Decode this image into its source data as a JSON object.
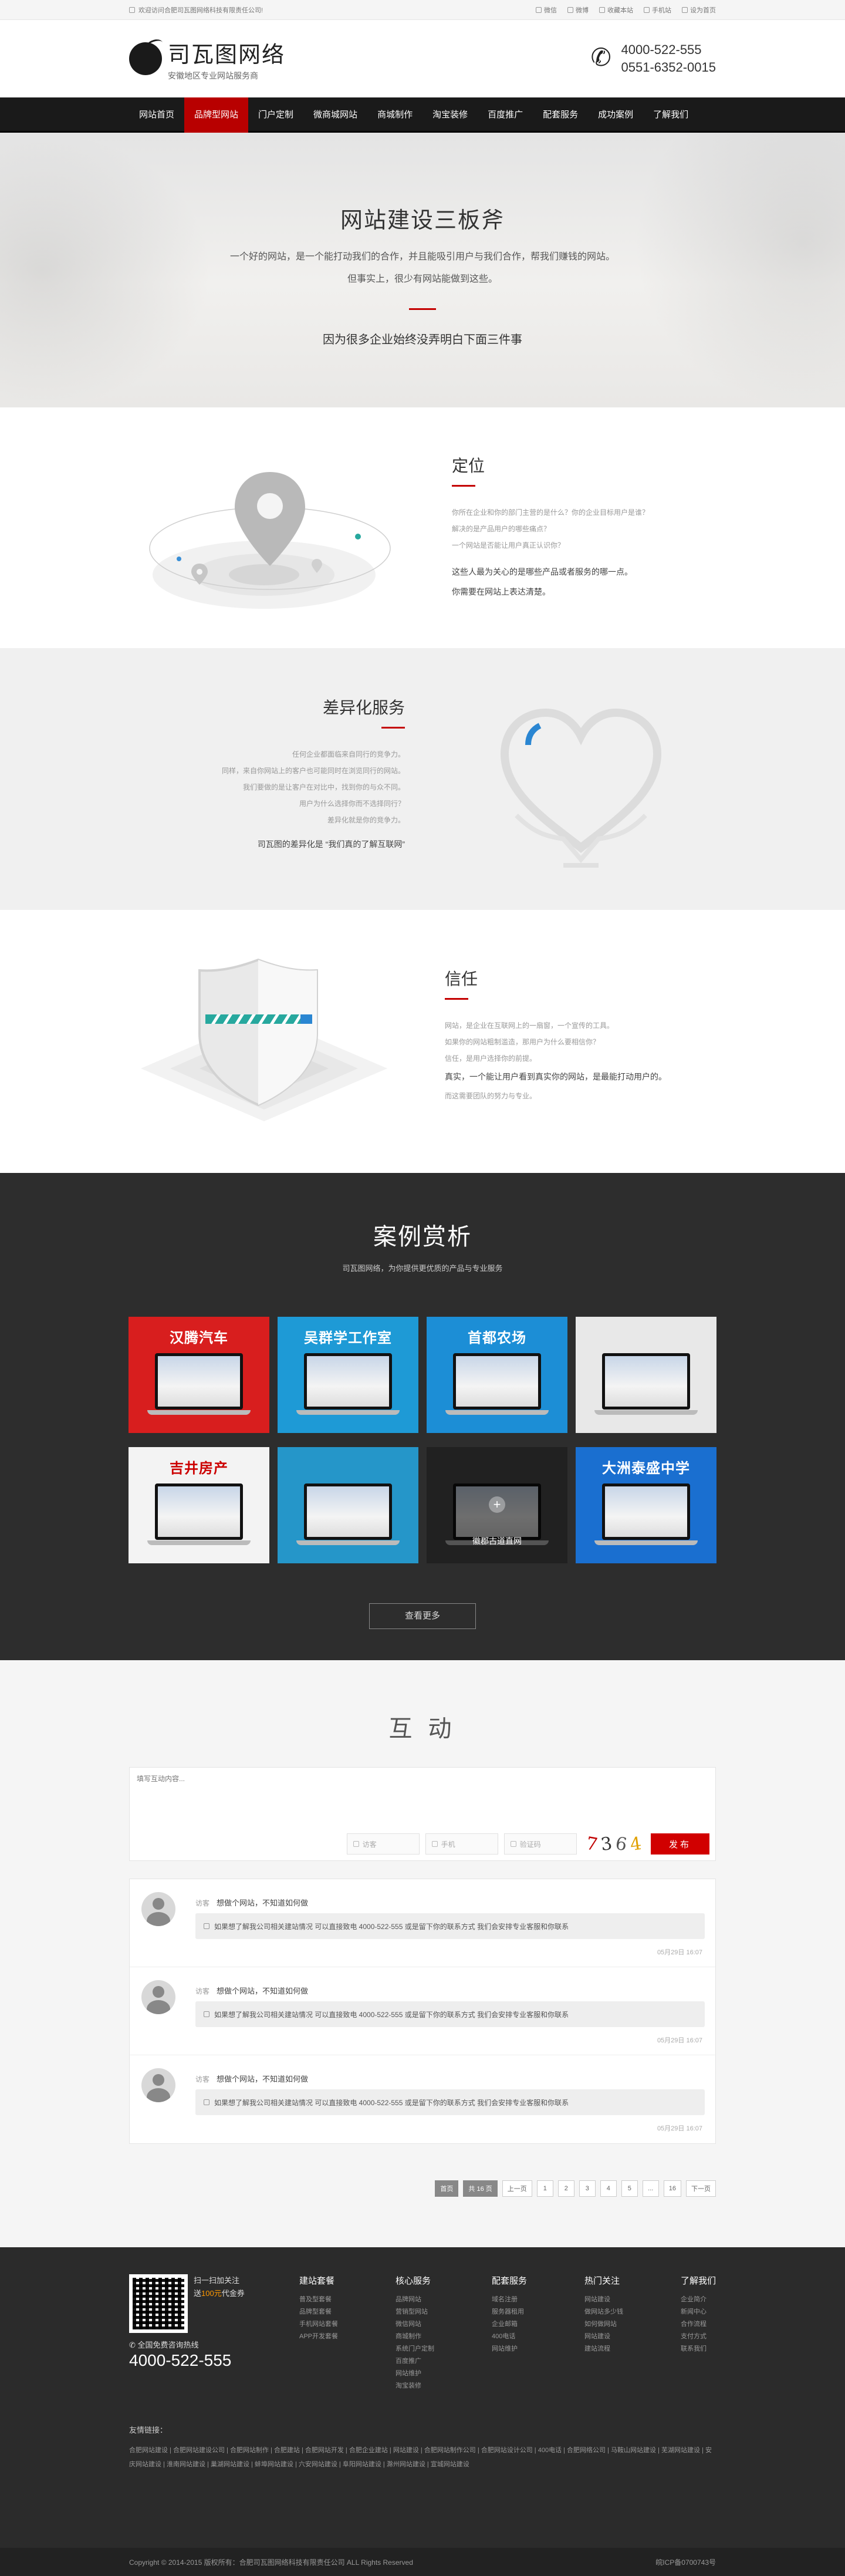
{
  "topbar": {
    "welcome": "欢迎访问合肥司瓦图网络科技有限责任公司!",
    "links": [
      "微信",
      "微博",
      "收藏本站",
      "手机站",
      "设为首页"
    ]
  },
  "header": {
    "logo_name": "司瓦图网络",
    "logo_slogan": "安徽地区专业网站服务商",
    "phone1": "4000-522-555",
    "phone2": "0551-6352-0015"
  },
  "nav": {
    "items": [
      "网站首页",
      "品牌型网站",
      "门户定制",
      "微商城网站",
      "商城制作",
      "淘宝装修",
      "百度推广",
      "配套服务",
      "成功案例",
      "了解我们"
    ],
    "active_index": 1
  },
  "banner": {
    "title": "网站建设三板斧",
    "line1": "一个好的网站，是一个能打动我们的合作，并且能吸引用户与我们合作，帮我们赚钱的网站。",
    "line2": "但事实上，很少有网站能做到这些。",
    "subtitle": "因为很多企业始终没弄明白下面三件事"
  },
  "features": {
    "dingwei": {
      "title": "定位",
      "lines": [
        "你所在企业和你的部门主营的是什么？你的企业目标用户是谁？",
        "解决的是产品用户的哪些痛点？",
        "一个网站是否能让用户真正认识你？"
      ],
      "em1": "这些人最为关心的是哪些产品或者服务的哪一点。",
      "em2": "你需要在网站上表达清楚。"
    },
    "chayi": {
      "title": "差异化服务",
      "lines": [
        "任何企业都面临来自同行的竞争力。",
        "同样，来自你网站上的客户也可能同时在浏览同行的网站。",
        "我们要做的是让客户在对比中，找到你的与众不同。",
        "用户为什么选择你而不选择同行？",
        "差异化就是你的竞争力。"
      ],
      "em": "司瓦图的差异化是 “我们真的了解互联网”"
    },
    "xinren": {
      "title": "信任",
      "lines": [
        "网站，是企业在互联网上的一扇窗，一个宣传的工具。",
        "如果你的网站粗制滥造，那用户为什么要相信你？",
        "信任，是用户选择你的前提。"
      ],
      "em": "真实，一个能让用户看到真实你的网站，是最能打动用户的。",
      "note": "而这需要团队的努力与专业。"
    }
  },
  "cases": {
    "title": "案例赏析",
    "subtitle": "司瓦图网络，为你提供更优质的产品与专业服务",
    "items": [
      {
        "caption": "汉腾汽车",
        "bg": "#d81e1e"
      },
      {
        "caption": "吴群学工作室",
        "bg": "#1e9ad6"
      },
      {
        "caption": "首都农场",
        "bg": "#1c8ed6"
      },
      {
        "caption": "",
        "bg": "#e8e8e8"
      },
      {
        "caption": "吉井房产",
        "bg": "#f3f3f3"
      },
      {
        "caption": "",
        "bg": "#2596c9"
      },
      {
        "caption": "",
        "bg": "#4a4a4a"
      },
      {
        "caption": "大洲泰盛中学",
        "bg": "#1a6fd0"
      }
    ],
    "hover_text": "徽郡古道直网",
    "more_label": "查看更多"
  },
  "interact": {
    "title": "互 动",
    "textarea_placeholder": "填写互动内容...",
    "name_placeholder": "访客",
    "phone_placeholder": "手机",
    "captcha_placeholder": "验证码",
    "captcha_chars": [
      {
        "c": "7",
        "color": "#c00000"
      },
      {
        "c": "3",
        "color": "#333"
      },
      {
        "c": "6",
        "color": "#555"
      },
      {
        "c": "4",
        "color": "#e0a000"
      }
    ],
    "submit_label": "发布",
    "comments": [
      {
        "user": "访客",
        "question": "想做个网站，不知道如何做",
        "reply": "如果想了解我公司相关建站情况 可以直接致电 4000-522-555 或是留下你的联系方式 我们会安排专业客服和你联系",
        "time": "05月29日 16:07"
      },
      {
        "user": "访客",
        "question": "想做个网站，不知道如何做",
        "reply": "如果想了解我公司相关建站情况 可以直接致电 4000-522-555 或是留下你的联系方式 我们会安排专业客服和你联系",
        "time": "05月29日 16:07"
      },
      {
        "user": "访客",
        "question": "想做个网站，不知道如何做",
        "reply": "如果想了解我公司相关建站情况 可以直接致电 4000-522-555 或是留下你的联系方式 我们会安排专业客服和你联系",
        "time": "05月29日 16:07"
      }
    ],
    "pager": [
      "首页",
      "共 16 页",
      "上一页",
      "1",
      "2",
      "3",
      "4",
      "5",
      "...",
      "16",
      "下一页"
    ]
  },
  "footer": {
    "qr_text_1": "扫一扫加关注",
    "qr_text_2": "送",
    "qr_text_orange": "100元",
    "qr_text_3": "代金券",
    "call_label": "全国免费咨询热线",
    "phone": "4000-522-555",
    "columns": [
      {
        "title": "建站套餐",
        "items": [
          "普及型套餐",
          "品牌型套餐",
          "手机网站套餐",
          "APP开发套餐"
        ]
      },
      {
        "title": "核心服务",
        "items": [
          "品牌网站",
          "营销型网站",
          "微信网站",
          "商城制作",
          "系统门户定制",
          "百度推广",
          "网站维护",
          "淘宝装修"
        ]
      },
      {
        "title": "配套服务",
        "items": [
          "域名注册",
          "服务器租用",
          "企业邮箱",
          "400电话",
          "网站维护"
        ]
      },
      {
        "title": "热门关注",
        "items": [
          "网站建设",
          "做网站多少钱",
          "如何做网站",
          "网站建设",
          "建站流程"
        ]
      },
      {
        "title": "了解我们",
        "items": [
          "企业简介",
          "新闻中心",
          "合作流程",
          "支付方式",
          "联系我们"
        ]
      }
    ],
    "links_title": "友情链接：",
    "links": "合肥网站建设 | 合肥网站建设公司 | 合肥网站制作 | 合肥建站 | 合肥网站开发 | 合肥企业建站 | 网站建设 | 合肥网站制作公司 | 合肥网站设计公司 | 400电话 | 合肥网络公司 | 马鞍山网站建设 | 芜湖网站建设 | 安庆网站建设 | 淮南网站建设 | 巢湖网站建设 | 蚌埠网站建设 | 六安网站建设 | 阜阳网站建设 | 滁州网站建设 | 宣城网站建设",
    "copyright": "Copyright © 2014-2015 版权所有：合肥司瓦图网络科技有限责任公司  ALL Rights Reserved",
    "icp": "皖ICP备0700743号"
  }
}
